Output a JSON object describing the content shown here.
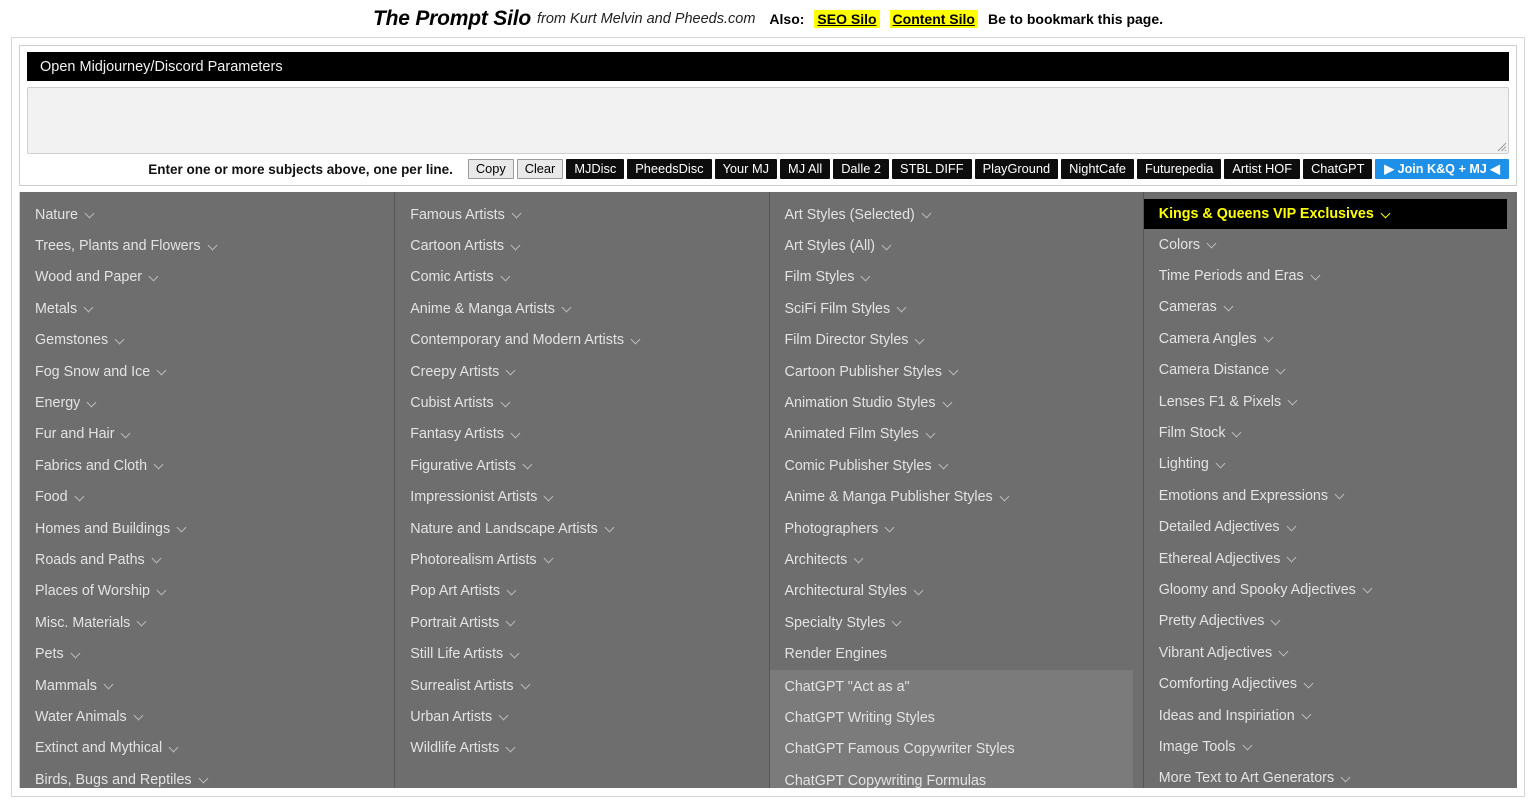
{
  "header": {
    "title": "The Prompt Silo",
    "byline": "from Kurt Melvin and Pheeds.com",
    "also_label": "Also:",
    "links": [
      {
        "label": "SEO Silo"
      },
      {
        "label": "Content Silo"
      }
    ],
    "tail": "Be to bookmark this page."
  },
  "params": {
    "label": "Open Midjourney/Discord Parameters"
  },
  "subject_input": {
    "value": "",
    "placeholder": ""
  },
  "toolbar": {
    "hint": "Enter one or more subjects above, one per line.",
    "buttons": [
      {
        "label": "Copy",
        "style": "light"
      },
      {
        "label": "Clear",
        "style": "light"
      },
      {
        "label": "MJDisc",
        "style": "dark"
      },
      {
        "label": "PheedsDisc",
        "style": "dark"
      },
      {
        "label": "Your MJ",
        "style": "dark"
      },
      {
        "label": "MJ All",
        "style": "dark"
      },
      {
        "label": "Dalle 2",
        "style": "dark"
      },
      {
        "label": "STBL DIFF",
        "style": "dark"
      },
      {
        "label": "PlayGround",
        "style": "dark"
      },
      {
        "label": "NightCafe",
        "style": "dark"
      },
      {
        "label": "Futurepedia",
        "style": "dark"
      },
      {
        "label": "Artist HOF",
        "style": "dark"
      },
      {
        "label": "ChatGPT",
        "style": "dark"
      },
      {
        "label": "▶ Join K&Q + MJ ◀",
        "style": "join"
      }
    ]
  },
  "columns": [
    {
      "name": "subjects",
      "items": [
        {
          "label": "Nature",
          "chevron": true
        },
        {
          "label": "Trees, Plants and Flowers",
          "chevron": true
        },
        {
          "label": "Wood and Paper",
          "chevron": true
        },
        {
          "label": "Metals",
          "chevron": true
        },
        {
          "label": "Gemstones",
          "chevron": true
        },
        {
          "label": "Fog Snow and Ice",
          "chevron": true
        },
        {
          "label": "Energy",
          "chevron": true
        },
        {
          "label": "Fur and Hair",
          "chevron": true
        },
        {
          "label": "Fabrics and Cloth",
          "chevron": true
        },
        {
          "label": "Food",
          "chevron": true
        },
        {
          "label": "Homes and Buildings",
          "chevron": true
        },
        {
          "label": "Roads and Paths",
          "chevron": true
        },
        {
          "label": "Places of Worship",
          "chevron": true
        },
        {
          "label": "Misc. Materials",
          "chevron": true
        },
        {
          "label": "Pets",
          "chevron": true
        },
        {
          "label": "Mammals",
          "chevron": true
        },
        {
          "label": "Water Animals",
          "chevron": true
        },
        {
          "label": "Extinct and Mythical",
          "chevron": true
        },
        {
          "label": "Birds, Bugs and Reptiles",
          "chevron": true
        }
      ]
    },
    {
      "name": "artists",
      "items": [
        {
          "label": "Famous Artists",
          "chevron": true
        },
        {
          "label": "Cartoon Artists",
          "chevron": true
        },
        {
          "label": "Comic Artists",
          "chevron": true
        },
        {
          "label": "Anime & Manga Artists",
          "chevron": true
        },
        {
          "label": "Contemporary and Modern Artists",
          "chevron": true
        },
        {
          "label": "Creepy Artists",
          "chevron": true
        },
        {
          "label": "Cubist Artists",
          "chevron": true
        },
        {
          "label": "Fantasy Artists",
          "chevron": true
        },
        {
          "label": "Figurative Artists",
          "chevron": true
        },
        {
          "label": "Impressionist Artists",
          "chevron": true
        },
        {
          "label": "Nature and Landscape Artists",
          "chevron": true
        },
        {
          "label": "Photorealism Artists",
          "chevron": true
        },
        {
          "label": "Pop Art Artists",
          "chevron": true
        },
        {
          "label": "Portrait Artists",
          "chevron": true
        },
        {
          "label": "Still Life Artists",
          "chevron": true
        },
        {
          "label": "Surrealist Artists",
          "chevron": true
        },
        {
          "label": "Urban Artists",
          "chevron": true
        },
        {
          "label": "Wildlife Artists",
          "chevron": true
        }
      ]
    },
    {
      "name": "styles",
      "items": [
        {
          "label": "Art Styles (Selected)",
          "chevron": true
        },
        {
          "label": "Art Styles (All)",
          "chevron": true
        },
        {
          "label": "Film Styles",
          "chevron": true
        },
        {
          "label": "SciFi Film Styles",
          "chevron": true
        },
        {
          "label": "Film Director Styles",
          "chevron": true
        },
        {
          "label": "Cartoon Publisher Styles",
          "chevron": true
        },
        {
          "label": "Animation Studio Styles",
          "chevron": true
        },
        {
          "label": "Animated Film Styles",
          "chevron": true
        },
        {
          "label": "Comic Publisher Styles",
          "chevron": true
        },
        {
          "label": "Anime & Manga Publisher Styles",
          "chevron": true
        },
        {
          "label": "Photographers",
          "chevron": true
        },
        {
          "label": "Architects",
          "chevron": true
        },
        {
          "label": "Architectural Styles",
          "chevron": true
        },
        {
          "label": "Specialty Styles",
          "chevron": true
        },
        {
          "label": "Render Engines",
          "chevron": false
        }
      ],
      "subgroup": {
        "name": "chatgpt-group",
        "items": [
          {
            "label": "ChatGPT \"Act as a\"",
            "chevron": false
          },
          {
            "label": "ChatGPT Writing Styles",
            "chevron": false
          },
          {
            "label": "ChatGPT Famous Copywriter Styles",
            "chevron": false
          },
          {
            "label": "ChatGPT Copywriting Formulas",
            "chevron": false
          }
        ]
      }
    },
    {
      "name": "modifiers",
      "items": [
        {
          "label": "Kings & Queens VIP Exclusives",
          "chevron": true,
          "vip": true
        },
        {
          "label": "Colors",
          "chevron": true
        },
        {
          "label": "Time Periods and Eras",
          "chevron": true
        },
        {
          "label": "Cameras",
          "chevron": true
        },
        {
          "label": "Camera Angles",
          "chevron": true
        },
        {
          "label": "Camera Distance",
          "chevron": true
        },
        {
          "label": "Lenses F1 & Pixels",
          "chevron": true
        },
        {
          "label": "Film Stock",
          "chevron": true
        },
        {
          "label": "Lighting",
          "chevron": true
        },
        {
          "label": "Emotions and Expressions",
          "chevron": true
        },
        {
          "label": "Detailed Adjectives",
          "chevron": true
        },
        {
          "label": "Ethereal Adjectives",
          "chevron": true
        },
        {
          "label": "Gloomy and Spooky Adjectives",
          "chevron": true
        },
        {
          "label": "Pretty Adjectives",
          "chevron": true
        },
        {
          "label": "Vibrant Adjectives",
          "chevron": true
        },
        {
          "label": "Comforting Adjectives",
          "chevron": true
        },
        {
          "label": "Ideas and Inspiriation",
          "chevron": true
        },
        {
          "label": "Image Tools",
          "chevron": true
        },
        {
          "label": "More Text to Art Generators",
          "chevron": true
        }
      ]
    }
  ],
  "colors": {
    "column_bg": "#6e6e6e",
    "subgroup_bg": "#7b7b7b",
    "vip_bg": "#000000",
    "vip_text": "#ffff00",
    "highlight": "#ffff00",
    "join_button": "#1e90e8",
    "dark_button": "#0d0d0d"
  }
}
